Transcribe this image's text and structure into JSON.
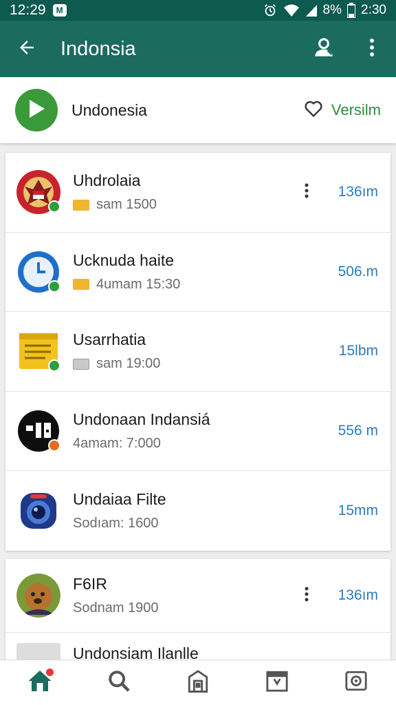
{
  "status_bar": {
    "time_left": "12:29",
    "notification_glyph": "M",
    "battery": "8%",
    "time_right": "2:30"
  },
  "appbar": {
    "title": "Indonsia",
    "back_icon": "arrow-left-icon",
    "profile_icon": "person-icon",
    "more_icon": "more-vert-icon"
  },
  "top_card": {
    "name": "Undonesia",
    "favorite_label": "Versilm",
    "play_color": "#3a9a3a"
  },
  "list_items": [
    {
      "title": "Uhdrolaia",
      "subtitle": "sam 1500",
      "size": "136ım",
      "avatar": "emblem",
      "badge_color": "#2e9e3a",
      "marker": "yellow",
      "has_more": true
    },
    {
      "title": "Ucknuda haite",
      "subtitle": "4umam 15:30",
      "size": "506.m",
      "avatar": "clock",
      "badge_color": "#2e9e3a",
      "marker": "yellow",
      "has_more": false
    },
    {
      "title": "Usarrhatia",
      "subtitle": "sam 19:00",
      "size": "15lbm",
      "avatar": "notes",
      "badge_color": "#2e9e3a",
      "marker": "keyboard",
      "has_more": false
    },
    {
      "title": "Undonaan Indansiá",
      "subtitle": "4amam: 7:000",
      "size": "556 m",
      "avatar": "logo-black",
      "badge_color": "#e86a1a",
      "marker": "none",
      "has_more": false
    },
    {
      "title": "Undaiaa Filte",
      "subtitle": "Sodıam: 1600",
      "size": "15mm",
      "avatar": "camera",
      "badge_color": "",
      "marker": "none",
      "has_more": false
    }
  ],
  "list_items_2": [
    {
      "title": "F6IR",
      "subtitle": "Sodnam 1900",
      "size": "136ım",
      "avatar": "photo",
      "has_more": true
    }
  ],
  "peek_item": {
    "title": "Undonsiam Ilanlle"
  },
  "bottom_nav": [
    {
      "icon": "home-icon",
      "active": true
    },
    {
      "icon": "search-icon",
      "active": false
    },
    {
      "icon": "store-icon",
      "active": false
    },
    {
      "icon": "calendar-icon",
      "active": false
    },
    {
      "icon": "settings-icon",
      "active": false
    }
  ],
  "colors": {
    "status_bar": "#0d5a4f",
    "app_bar": "#1b6b5f",
    "size_text": "#2a7bbf",
    "accent_green": "#2e8b3e"
  }
}
